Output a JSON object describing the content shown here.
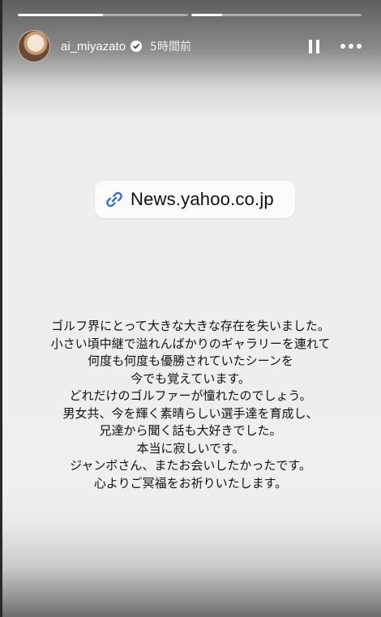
{
  "story": {
    "progress": [
      0.5,
      0.18
    ],
    "username": "ai_miyazato",
    "time_ago": "5時間前",
    "link_sticker": {
      "text": "News.yahoo.co.jp"
    },
    "message_lines": [
      "ゴルフ界にとって大きな大きな存在を失いました。",
      "小さい頃中継で溢れんばかりのギャラリーを連れて",
      "何度も何度も優勝されていたシーンを",
      "今でも覚えています。",
      "どれだけのゴルファーが憧れたのでしょう。",
      "男女共、今を輝く素晴らしい選手達を育成し、",
      "兄達から聞く話も大好きでした。",
      "本当に寂しいです。",
      "ジャンボさん、またお会いしたかったです。",
      "心よりご冥福をお祈りいたします。"
    ],
    "icons": {
      "verified": "verified-badge-icon",
      "pause": "pause-icon",
      "more": "more-options-icon",
      "link": "link-icon"
    },
    "colors": {
      "text": "#121212",
      "sticker_bg": "#fbfbfb",
      "link_icon": "#2f6fd6"
    }
  }
}
